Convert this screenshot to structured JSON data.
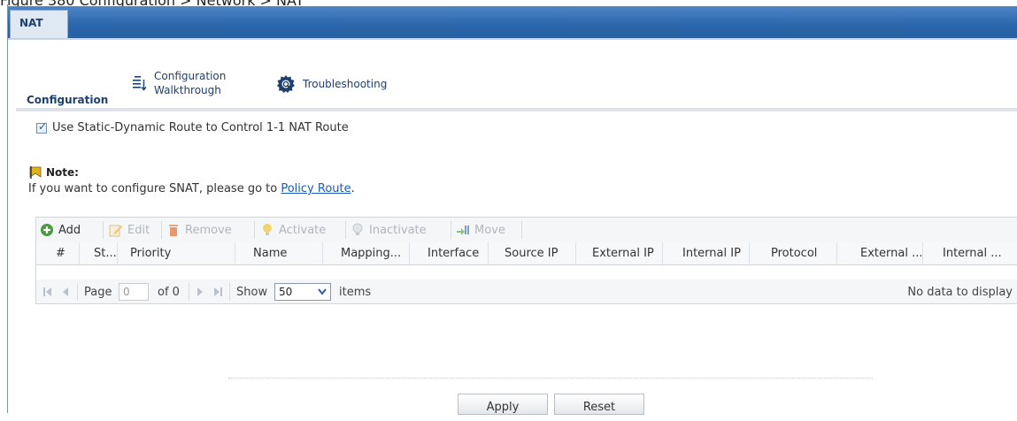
{
  "caption": "Figure 380   Configuration > Network > NAT",
  "tabs": [
    {
      "label": "NAT"
    }
  ],
  "toolbar": {
    "section_label": "Configuration",
    "walkthrough_line1": "Configuration",
    "walkthrough_line2": "Walkthrough",
    "troubleshooting_label": "Troubleshooting"
  },
  "options": {
    "static_dynamic_checked": true,
    "static_dynamic_label": "Use Static-Dynamic Route to Control 1-1 NAT Route"
  },
  "note": {
    "title": "Note:",
    "text_prefix": "If you want to configure SNAT, please go to ",
    "link_text": "Policy Route",
    "text_suffix": "."
  },
  "grid_toolbar": {
    "add": "Add",
    "edit": "Edit",
    "remove": "Remove",
    "activate": "Activate",
    "inactivate": "Inactivate",
    "move": "Move"
  },
  "columns": [
    "#",
    "St...",
    "Priority",
    "Name",
    "Mapping...",
    "Interface",
    "Source IP",
    "External IP",
    "Internal IP",
    "Protocol",
    "External ...",
    "Internal ..."
  ],
  "rows": [],
  "pager": {
    "page_label": "Page",
    "page_value": "0",
    "of_label": "of 0",
    "show_label": "Show",
    "page_size": "50",
    "items_label": "items",
    "empty_text": "No data to display"
  },
  "buttons": {
    "apply": "Apply",
    "reset": "Reset"
  },
  "colors": {
    "tab_bar": "#2d68ad",
    "link": "#1a5bb8",
    "header_text": "#1f3f6e"
  }
}
